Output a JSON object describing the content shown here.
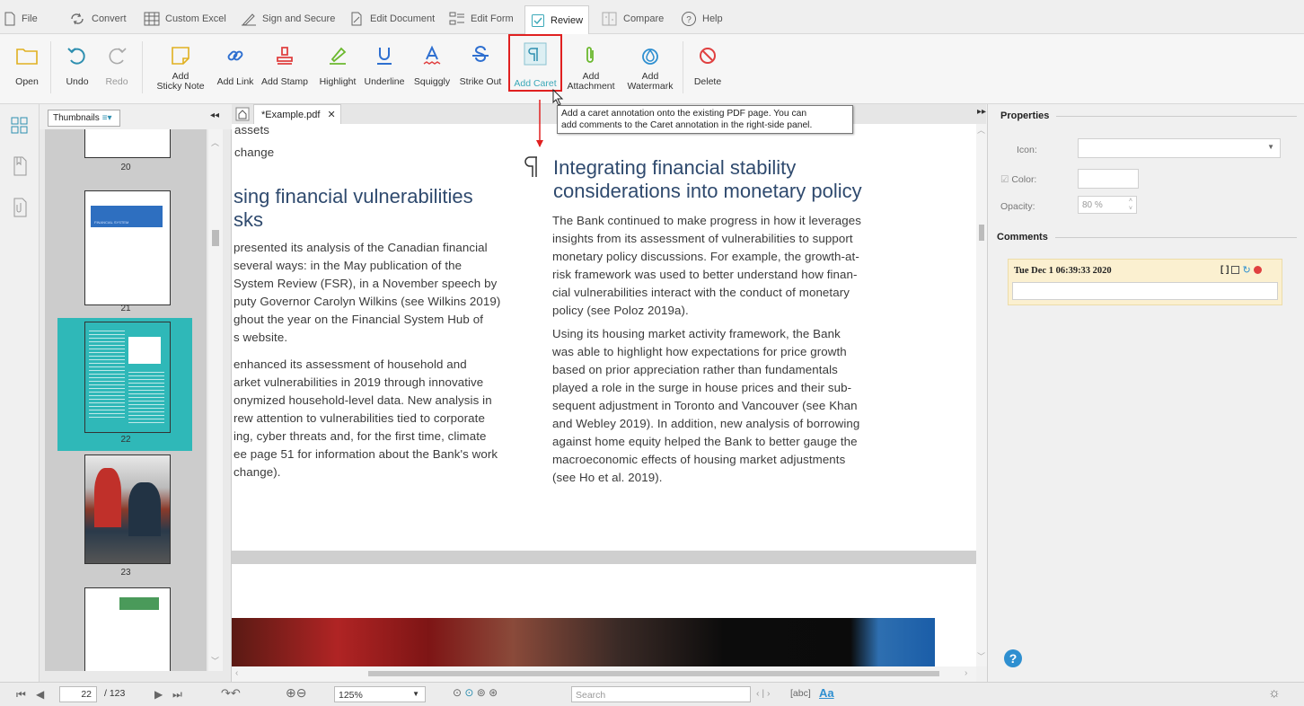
{
  "menu": {
    "items": [
      {
        "label": "File",
        "icon": "file-icon"
      },
      {
        "label": "Convert",
        "icon": "convert-icon"
      },
      {
        "label": "Custom Excel",
        "icon": "table-icon"
      },
      {
        "label": "Sign and Secure",
        "icon": "sign-icon"
      },
      {
        "label": "Edit Document",
        "icon": "edit-doc-icon"
      },
      {
        "label": "Edit Form",
        "icon": "form-icon"
      },
      {
        "label": "Review",
        "icon": "review-icon"
      },
      {
        "label": "Compare",
        "icon": "compare-icon"
      },
      {
        "label": "Help",
        "icon": "help-icon"
      }
    ],
    "active": "Review"
  },
  "ribbon": {
    "open": "Open",
    "undo": "Undo",
    "redo": "Redo",
    "sticky_note": "Add\nSticky Note",
    "add_link": "Add Link",
    "add_stamp": "Add Stamp",
    "highlight": "Highlight",
    "underline": "Underline",
    "squiggly": "Squiggly",
    "strike_out": "Strike Out",
    "add_caret": "Add Caret",
    "add_attachment": "Add\nAttachment",
    "add_watermark": "Add\nWatermark",
    "delete": "Delete",
    "accent": "#3aa8b8",
    "highlight_box": "#e02020"
  },
  "tooltip": {
    "line1": "Add a caret annotation onto the existing PDF page. You can",
    "line2": "add comments to the Caret annotation in the right-side panel."
  },
  "thumbnails": {
    "selector": "Thumbnails",
    "pages": [
      "20",
      "21",
      "22",
      "23"
    ],
    "selected_page": "22",
    "page21_banner": "FINANCIAL SYSTEM"
  },
  "doc": {
    "tab_label": "*Example.pdf",
    "left_col_lines": [
      "assets",
      "change"
    ],
    "left_heading": [
      "sing financial vulnerabilities",
      "sks"
    ],
    "left_para1": [
      "presented its analysis of the Canadian financial",
      "several ways: in the May publication of the",
      "System Review (FSR), in a November speech by",
      "puty Governor Carolyn Wilkins (see Wilkins 2019)",
      "ghout the year on the Financial System Hub of",
      "s website."
    ],
    "left_para2": [
      "enhanced its assessment of household and",
      "arket vulnerabilities in 2019 through innovative",
      "onymized household-level data. New analysis in",
      "rew attention to vulnerabilities tied to corporate",
      "ing, cyber threats and, for the first time, climate",
      "ee page 51 for information about the Bank's work",
      "change)."
    ],
    "right_heading": [
      "Integrating financial stability",
      "considerations into monetary policy"
    ],
    "right_para1": [
      "The Bank continued to make progress in how it leverages",
      "insights from its assessment of vulnerabilities to support",
      "monetary policy discussions. For example, the growth-at-",
      "risk framework was used to better understand how finan-",
      "cial vulnerabilities interact with the conduct of monetary",
      "policy (see Poloz 2019a)."
    ],
    "right_para2": [
      "Using its housing market activity framework, the Bank",
      "was able to highlight how expectations for price growth",
      "based on prior appreciation rather than fundamentals",
      "played a role in the surge in house prices and their sub-",
      "sequent adjustment in Toronto and Vancouver (see Khan",
      "and Webley 2019). In addition, new analysis of borrowing",
      "against home equity helped the Bank to better gauge the",
      "macroeconomic effects of housing market adjustments",
      "(see Ho et al. 2019)."
    ]
  },
  "properties": {
    "title": "Properties",
    "icon_label": "Icon:",
    "color_label": "Color:",
    "opacity_label": "Opacity:",
    "opacity_value": "80 %",
    "comments_title": "Comments",
    "comment_date": "Tue Dec 1 06:39:33 2020",
    "comment_bg": "#fbf0d0"
  },
  "status": {
    "page_current": "22",
    "page_total": "/ 123",
    "zoom": "125%",
    "search_placeholder": "Search",
    "abc": "[abc]",
    "aa": "Aa"
  }
}
